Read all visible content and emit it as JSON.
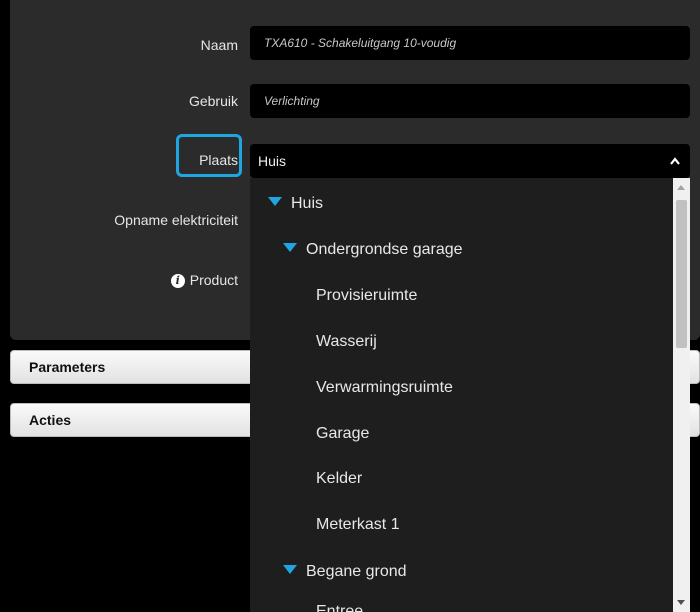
{
  "form": {
    "naam_label": "Naam",
    "naam_value": "TXA610 - Schakeluitgang 10-voudig",
    "gebruik_label": "Gebruik",
    "gebruik_value": "Verlichting",
    "plaats_label": "Plaats",
    "plaats_value": "Huis",
    "opname_label": "Opname elektriciteit",
    "product_label": "Product"
  },
  "sections": {
    "parameters": "Parameters",
    "acties": "Acties"
  },
  "dropdown": {
    "items": [
      {
        "label": "Huis",
        "expanded": true
      },
      {
        "label": "Ondergrondse garage",
        "expanded": true
      },
      {
        "label": "Provisieruimte"
      },
      {
        "label": "Wasserij"
      },
      {
        "label": "Verwarmingsruimte"
      },
      {
        "label": "Garage"
      },
      {
        "label": "Kelder"
      },
      {
        "label": "Meterkast 1"
      },
      {
        "label": "Begane grond",
        "expanded": true
      },
      {
        "label": "Entree"
      }
    ]
  },
  "colors": {
    "accent": "#1fa6e0",
    "panel": "#2b2b2b",
    "background": "#000000"
  },
  "icons": {
    "product_info": "info-icon",
    "select_toggle": "chevron-up-icon",
    "tree_expand": "triangle-down-icon"
  }
}
